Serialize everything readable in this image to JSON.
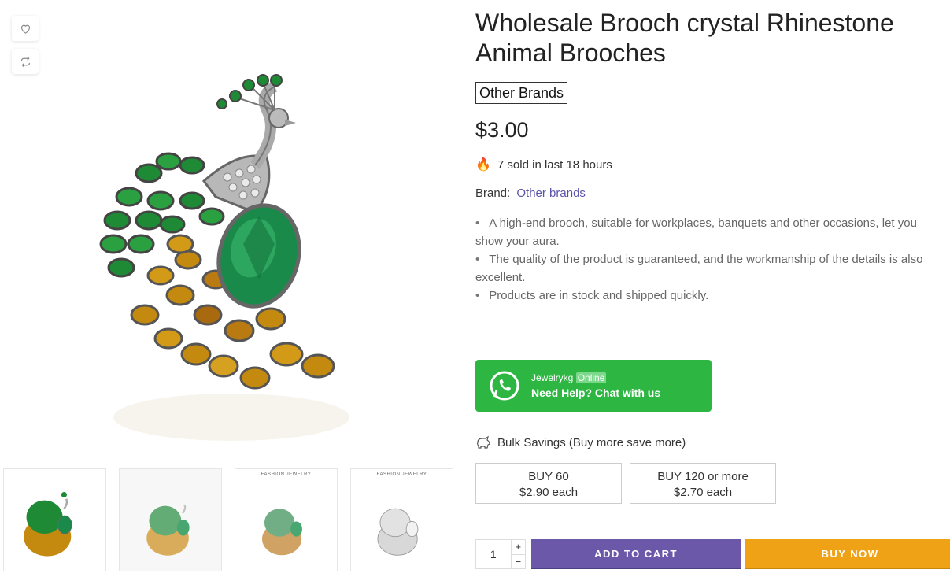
{
  "product": {
    "title": "Wholesale Brooch crystal Rhinestone Animal Brooches",
    "brand_tag": "Other Brands",
    "price": "$3.00",
    "sold_text": "7 sold in last 18 hours",
    "brand_label": "Brand:",
    "brand_link": "Other brands",
    "description": [
      "A high-end brooch, suitable for workplaces, banquets and other occasions, let you show your aura.",
      "The quality of the product is guaranteed, and the workmanship of the details is also excellent.",
      "Products are in stock and shipped quickly."
    ]
  },
  "whatsapp": {
    "name": "Jewelrykg",
    "status": "Online",
    "cta": "Need Help? Chat with us",
    "color": "#2db742"
  },
  "bulk": {
    "title": "Bulk Savings (Buy more save more)",
    "tiers": [
      {
        "qty": "BUY 60",
        "price": "$2.90 each"
      },
      {
        "qty": "BUY 120 or more",
        "price": "$2.70 each"
      }
    ]
  },
  "purchase": {
    "quantity": "1",
    "plus": "+",
    "minus": "−",
    "add_to_cart": "ADD TO CART",
    "buy_now": "BUY NOW",
    "cart_color": "#6b58a8",
    "buy_color": "#f0a216"
  },
  "gallery": {
    "icons": [
      "heart-icon",
      "compare-icon"
    ],
    "thumb_captions": [
      "",
      "",
      "FASHION JEWELRY",
      "FASHION JEWELRY"
    ]
  }
}
